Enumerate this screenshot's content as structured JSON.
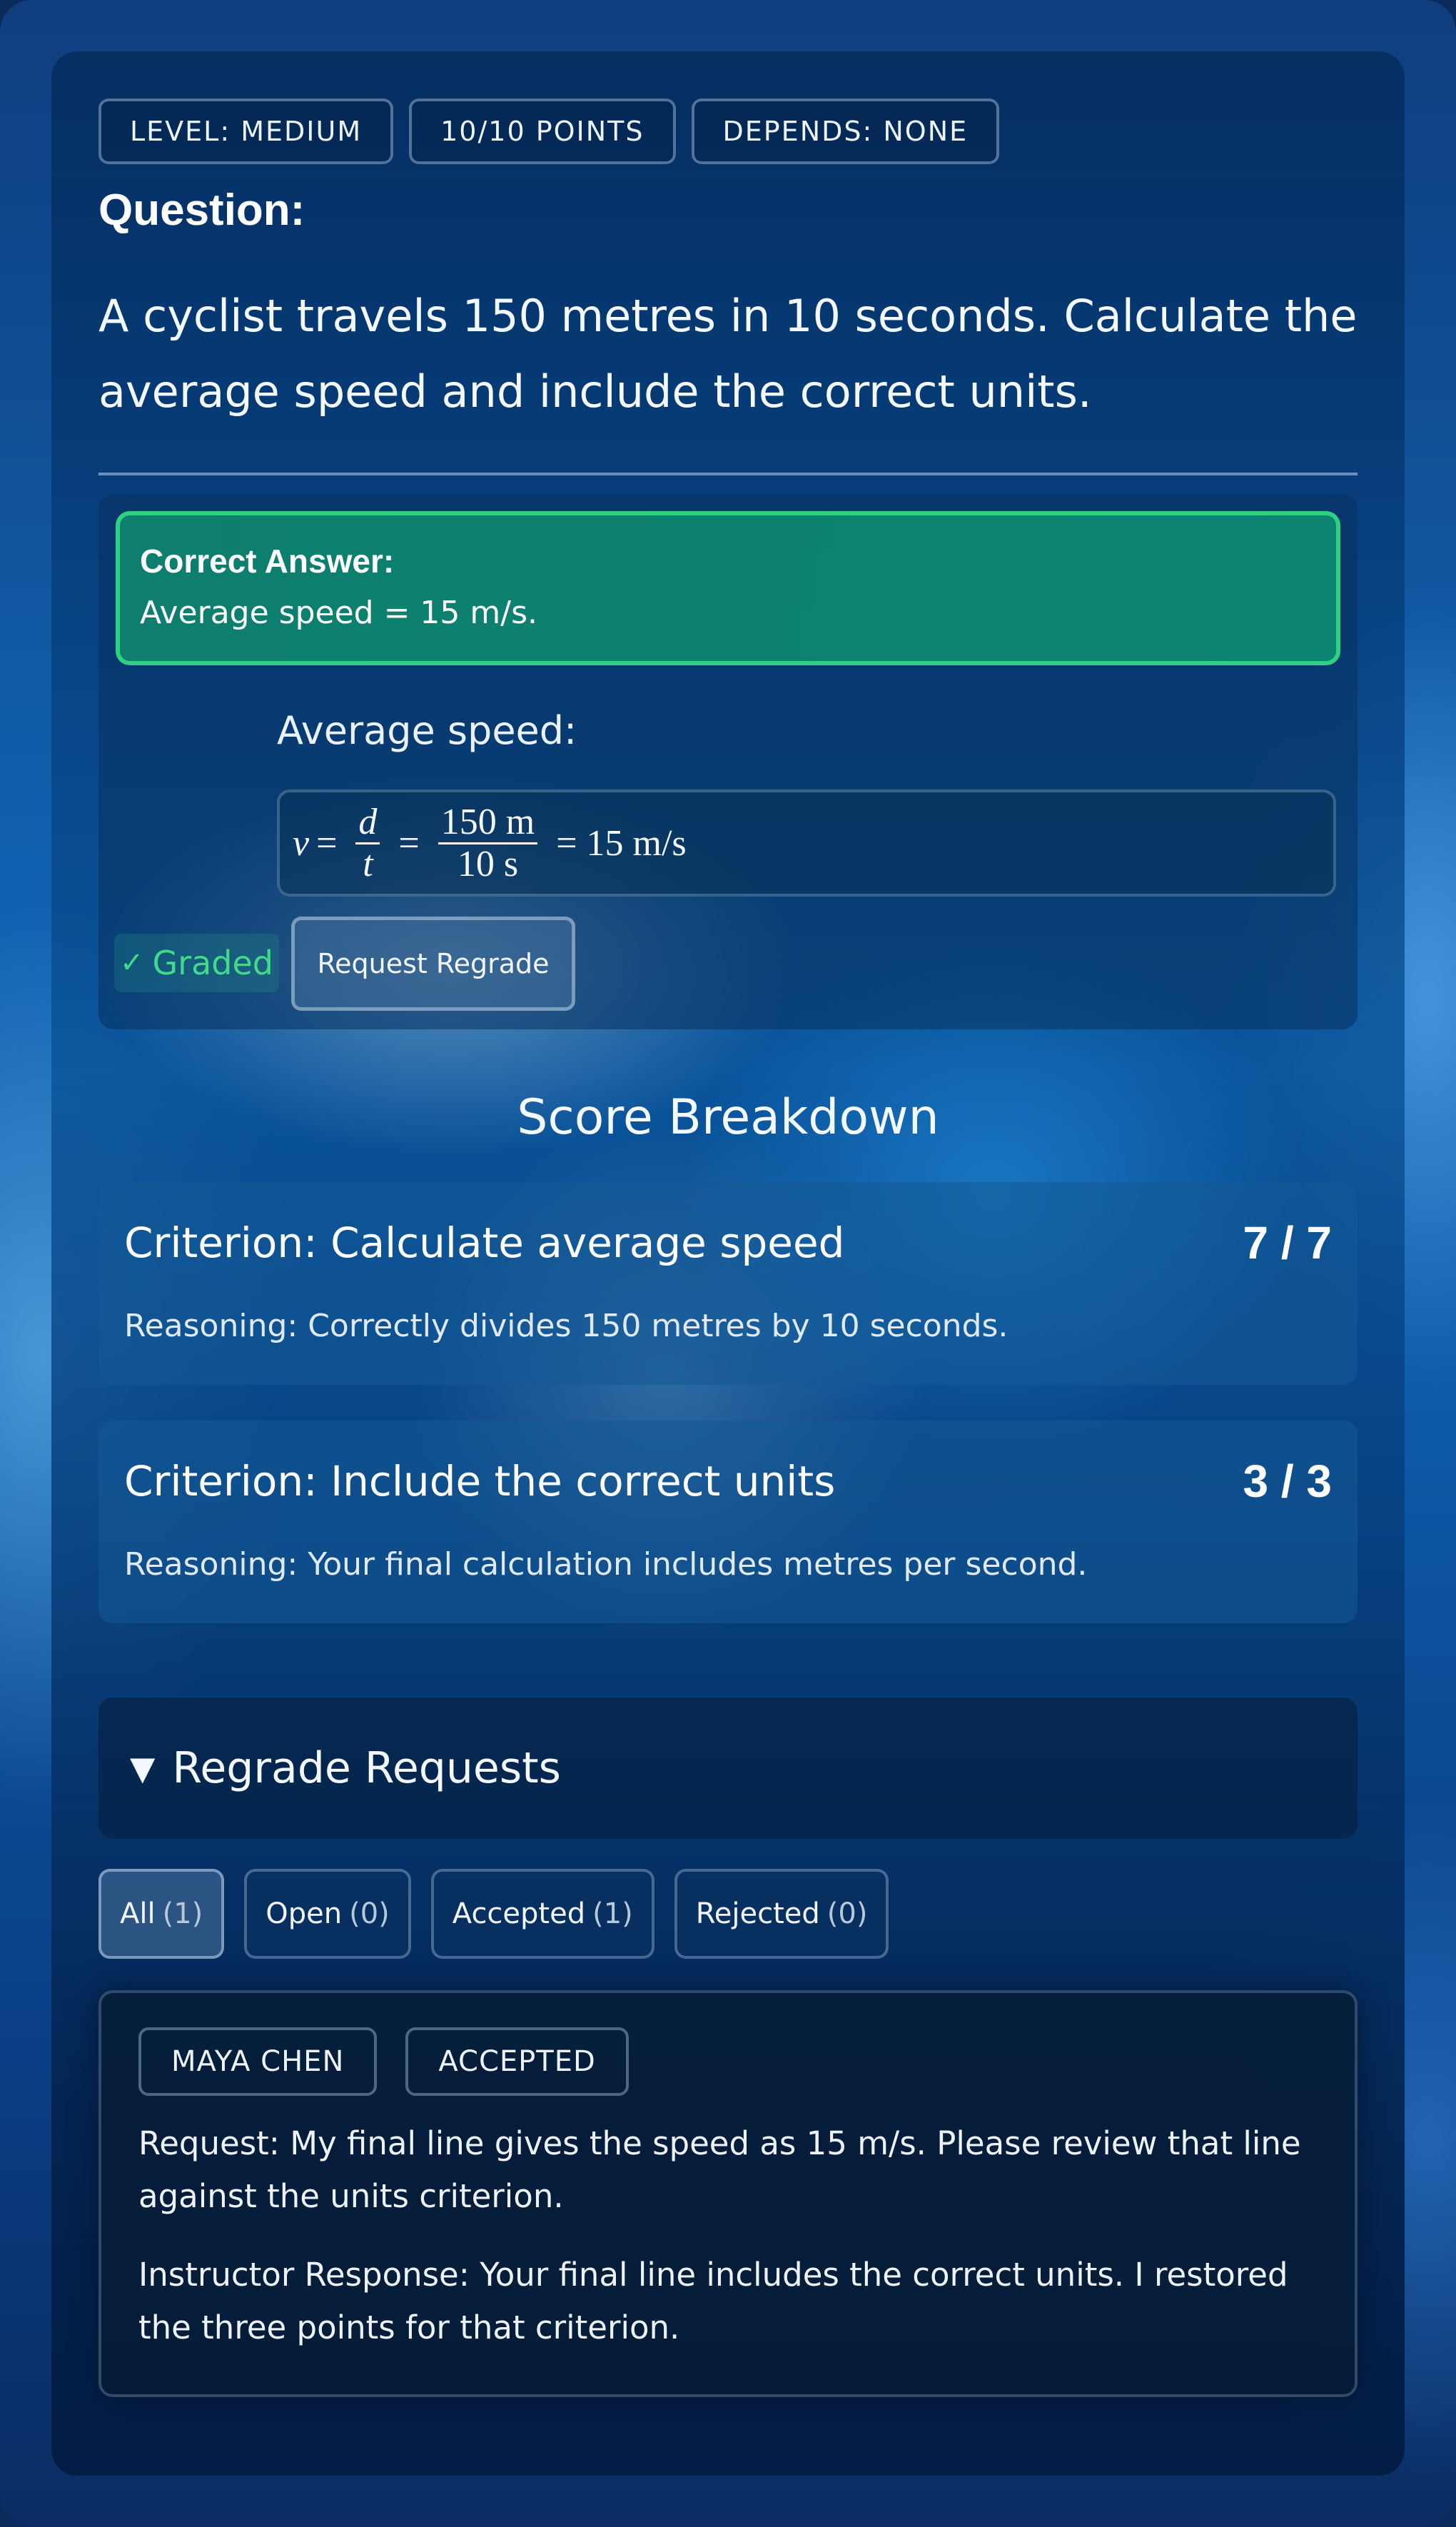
{
  "tags": {
    "level": "LEVEL:  MEDIUM",
    "points": "10/10  POINTS",
    "depends": "DEPENDS:  NONE"
  },
  "question": {
    "heading": "Question:",
    "text": "A cyclist travels 150 metres in 10 seconds. Calculate the average speed and include the correct units."
  },
  "answer": {
    "correct_label": "Correct Answer:",
    "correct_text": "Average speed = 15 m/s.",
    "avg_label": "Average speed:",
    "formula": {
      "v": "v",
      "eq": "=",
      "d": "d",
      "t": "t",
      "num": "150 m",
      "den": "10 s",
      "result": "= 15 m/s"
    },
    "graded_label": "Graded",
    "graded_icon": "check-icon",
    "regrade_button": "Request Regrade"
  },
  "score": {
    "title": "Score Breakdown",
    "criteria": [
      {
        "title": "Criterion: Calculate average speed",
        "score": "7 / 7",
        "reasoning": "Reasoning: Correctly divides 150 metres by 10 seconds."
      },
      {
        "title": "Criterion: Include the correct units",
        "score": "3 / 3",
        "reasoning": "Reasoning: Your final calculation includes metres per second."
      }
    ]
  },
  "regrades": {
    "header_icon": "triangle-down-icon",
    "header": "Regrade Requests",
    "filters": [
      {
        "label": "All",
        "count": "(1)"
      },
      {
        "label": "Open",
        "count": "(0)"
      },
      {
        "label": "Accepted",
        "count": "(1)"
      },
      {
        "label": "Rejected",
        "count": "(0)"
      }
    ],
    "request": {
      "student": "MAYA CHEN",
      "status": "ACCEPTED",
      "text": "Request: My final line gives the speed as 15 m/s. Please review that line against the units criterion.",
      "response": "Instructor Response: Your final line includes the correct units. I restored the three points for that criterion."
    }
  },
  "colors": {
    "accent_green": "#2fd080",
    "graded_green": "#41d98a",
    "background": "#0d5aa8"
  }
}
